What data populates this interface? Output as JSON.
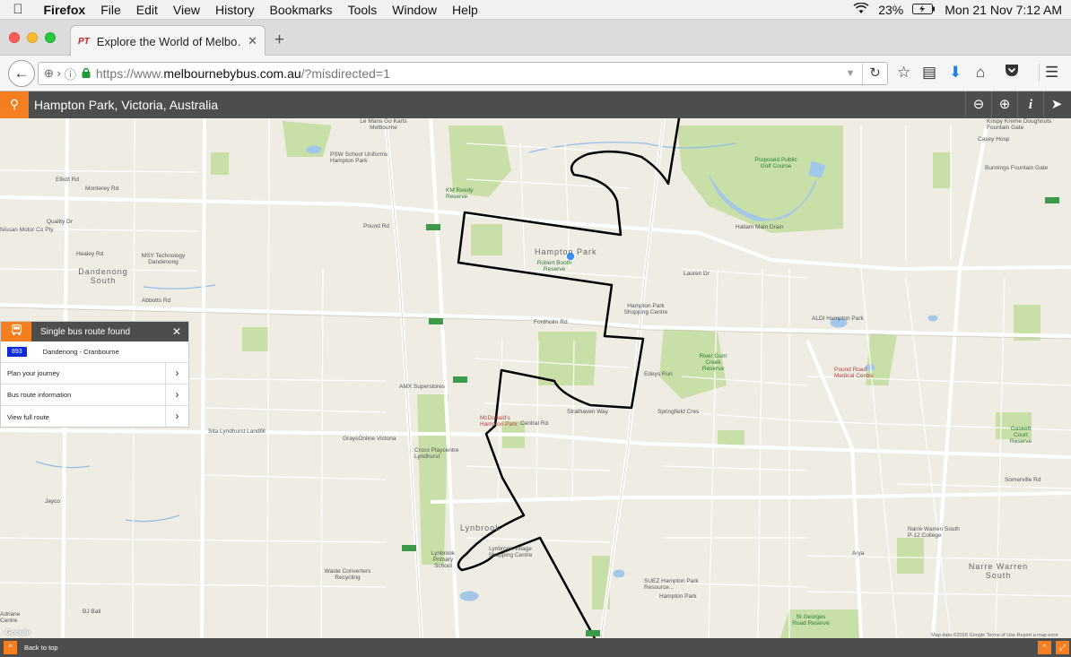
{
  "menubar": {
    "apple": "",
    "items": [
      "Firefox",
      "File",
      "Edit",
      "View",
      "History",
      "Bookmarks",
      "Tools",
      "Window",
      "Help"
    ],
    "battery": "23%",
    "clock": "Mon 21 Nov  7:12 AM"
  },
  "tab": {
    "favicon": "PT",
    "title": "Explore the World of Melbo…"
  },
  "navbar": {
    "url_prefix": "https://www.",
    "url_domain": "melbournebybus.com.au",
    "url_suffix": "/?misdirected=1"
  },
  "search": {
    "value": "Hampton Park, Victoria, Australia"
  },
  "panel": {
    "title": "Single bus route found",
    "route_number": "893",
    "route_name": "Dandenong - Cranbourne",
    "rows": [
      "Plan your journey",
      "Bus route information",
      "View full route"
    ]
  },
  "footer": {
    "back_to_top": "Back to top"
  },
  "map": {
    "google": "Google",
    "attribution": "Map data ©2016 Google   Terms of Use   Report a map error",
    "labels": {
      "hampton_park": "Hampton Park",
      "dandenong_south": "Dandenong South",
      "lynbrook": "Lynbrook",
      "narre_warren_south": "Narre Warren South",
      "robert_booth": "Robert Booth Reserve",
      "golf": "Proposed Public Golf Course",
      "km_reedy": "KM Reedy Reserve",
      "le_mans": "Le Mans Go Karts Melbourne",
      "psw": "PSW School Uniforms Hampton Park",
      "msy": "MSY Technology Dandenong",
      "aldi": "ALDI Hampton Park",
      "hp_shopping": "Hampton Park Shopping Centre",
      "amx": "AMX Superstores",
      "mcdonalds": "McDonald's Hampton Park",
      "grays": "GraysOnline Victoria",
      "sita": "Sita Lyndhurst Landfill",
      "crocs": "Crocs Playcentre Lyndhurst",
      "lynbrook_primary": "Lynbrook Primary School",
      "lynbrook_village": "Lynbrook Village Shopping Centre",
      "waste": "Waste Converters Recycling",
      "suez": "SUEZ Hampton Park Resource...",
      "hampton_park_road": "Hampton Park",
      "pound_road": "Pound Road Medical Centre",
      "river_gum": "River Gum Creek Reserve",
      "gaskett": "Gaskett Court Reserve",
      "narre_warren_college": "Narre Warren South P-12 College",
      "krispy": "Krispy Kreme Doughnuts Fountain Gate",
      "bunnings": "Bunnings Fountain Gate",
      "casey": "Casey Hosp",
      "st_georges": "St Georges Road Reserve",
      "arya": "Arya",
      "nissan": "Nissan Motor Co Pty",
      "jayco": "Jayco",
      "bj_ball": "BJ Ball",
      "adriane": "Adriane Centre",
      "lauren": "Lauren Dr",
      "hallam_main": "Hallam Main Drain",
      "fordholm": "Fordholm Rd",
      "abbotts": "Abbotts Rd",
      "pound": "Pound Rd",
      "quality": "Quality Dr",
      "elliott": "Elliott Rd",
      "monterey": "Monterey Rd",
      "healey": "Healey Rd",
      "central": "Central Rd",
      "edeys": "Edeys Run",
      "springfield": "Springfield Cres",
      "strathaven": "Strathaven Way",
      "somerville": "Somerville Rd"
    }
  }
}
